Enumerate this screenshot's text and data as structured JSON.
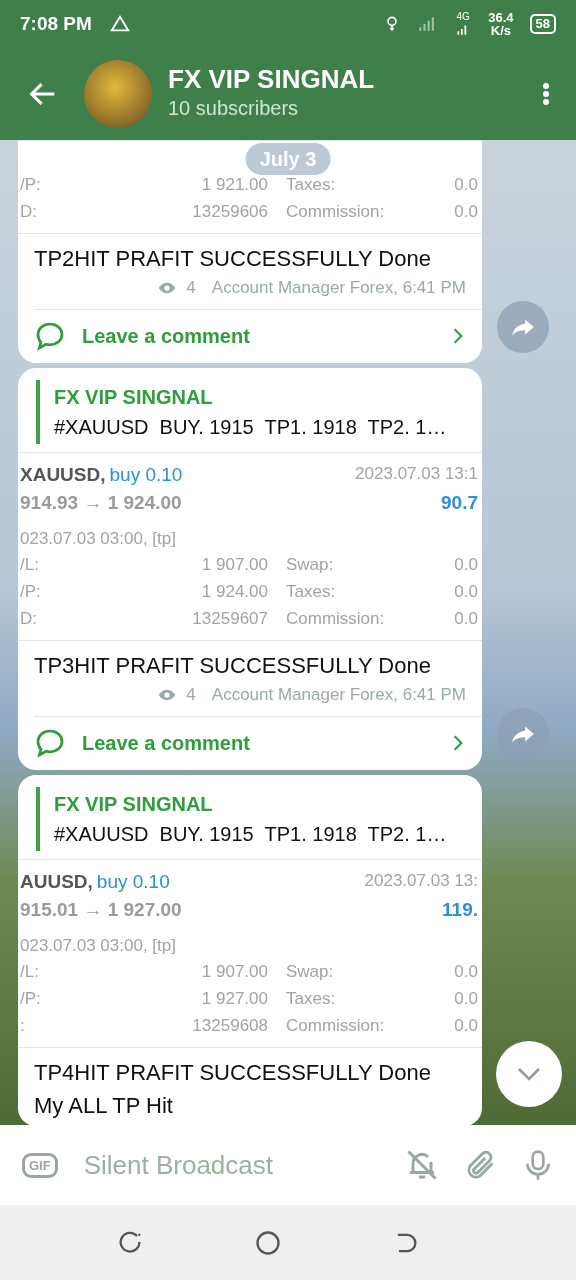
{
  "status_bar": {
    "time": "7:08 PM",
    "network": "4G",
    "speed": "36.4",
    "speed_unit": "K/s",
    "battery": "58"
  },
  "header": {
    "title": "FX VIP SINGNAL",
    "subtitle": "10 subscribers"
  },
  "date_pill": "July 3",
  "messages": [
    {
      "trade": {
        "rows": [
          {
            "label": "/P:",
            "value": "1 921.00",
            "label2": "Taxes:",
            "value2": "0.0"
          },
          {
            "label": "D:",
            "value": "13259606",
            "label2": "Commission:",
            "value2": "0.0"
          }
        ]
      },
      "text": "TP2HIT PRAFIT SUCCESSFULLY Done",
      "views": "4",
      "signature": "Account Manager Forex, 6:41 PM",
      "comment": "Leave a comment"
    },
    {
      "reply": {
        "author": "FX VIP SINGNAL",
        "text": "#XAUUSD  BUY. 1915  TP1. 1918  TP2. 1…"
      },
      "trade": {
        "symbol": "XAUUSD,",
        "side": "buy 0.10",
        "time": "2023.07.03 13:1",
        "prices": "914.93 → 1 924.00",
        "profit": "90.7",
        "open_time": "023.07.03 03:00, [tp]",
        "rows": [
          {
            "label": "/L:",
            "value": "1 907.00",
            "label2": "Swap:",
            "value2": "0.0"
          },
          {
            "label": "/P:",
            "value": "1 924.00",
            "label2": "Taxes:",
            "value2": "0.0"
          },
          {
            "label": "D:",
            "value": "13259607",
            "label2": "Commission:",
            "value2": "0.0"
          }
        ]
      },
      "text": "TP3HIT PRAFIT SUCCESSFULLY Done",
      "views": "4",
      "signature": "Account Manager Forex, 6:41 PM",
      "comment": "Leave a comment"
    },
    {
      "reply": {
        "author": "FX VIP SINGNAL",
        "text": "#XAUUSD  BUY. 1915  TP1. 1918  TP2. 1…"
      },
      "trade": {
        "symbol": "AUUSD,",
        "side": "buy 0.10",
        "time": "2023.07.03 13:",
        "prices": "915.01 → 1 927.00",
        "profit": "119.",
        "open_time": "023.07.03 03:00, [tp]",
        "rows": [
          {
            "label": "/L:",
            "value": "1 907.00",
            "label2": "Swap:",
            "value2": "0.0"
          },
          {
            "label": "/P:",
            "value": "1 927.00",
            "label2": "Taxes:",
            "value2": "0.0"
          },
          {
            "label": ":",
            "value": "13259608",
            "label2": "Commission:",
            "value2": "0.0"
          }
        ]
      },
      "text": "TP4HIT PRAFIT SUCCESSFULLY Done\nMy ALL TP Hit"
    }
  ],
  "input": {
    "gif": "GIF",
    "placeholder": "Silent Broadcast"
  }
}
